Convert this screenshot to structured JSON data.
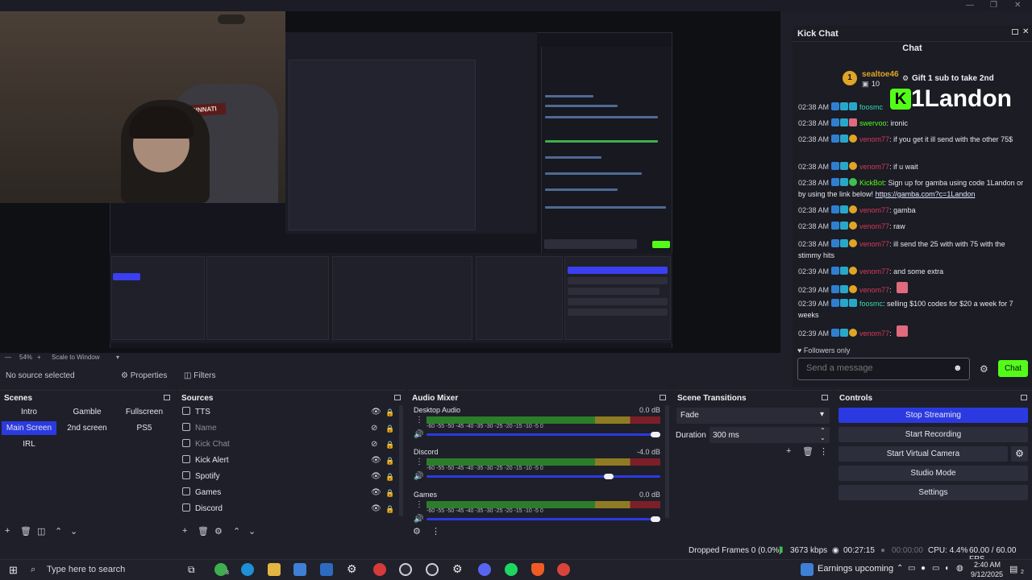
{
  "preview": {
    "cam_banner": "CINCINNATI",
    "zoom": "54%",
    "scale_mode": "Scale to Window"
  },
  "chat": {
    "dock_title": "Kick Chat",
    "title": "Chat",
    "pinned_user": "sealtoe46",
    "pinned_count": "10",
    "pinned_text": "Gift 1 sub to take 2nd",
    "overlay_name": "1Landon",
    "followers_only": "Followers only",
    "input_placeholder": "Send a message",
    "send_label": "Chat",
    "messages": [
      {
        "ts": "02:38 AM",
        "user": "foosmc",
        "text": "",
        "color": "teal"
      },
      {
        "ts": "02:38 AM",
        "user": "swervoo",
        "text": ": ironic",
        "color": "green"
      },
      {
        "ts": "02:38 AM",
        "user": "venom77",
        "text": ": if you get it ill send with the other 75$",
        "color": "red"
      },
      {
        "ts": "02:38 AM",
        "user": "venom77",
        "text": ": if u wait",
        "color": "red"
      },
      {
        "ts": "02:38 AM",
        "user": "KickBot",
        "text": ": Sign up for gamba using code 1Landon or by using the link below! ",
        "link": "https://gamba.com?c=1Landon",
        "color": "green"
      },
      {
        "ts": "02:38 AM",
        "user": "venom77",
        "text": ": gamba",
        "color": "red"
      },
      {
        "ts": "02:38 AM",
        "user": "venom77",
        "text": ": raw",
        "color": "red"
      },
      {
        "ts": "02:38 AM",
        "user": "venom77",
        "text": ": ill send the 25 with with 75 with the stimmy hits",
        "color": "red"
      },
      {
        "ts": "02:39 AM",
        "user": "venom77",
        "text": ": and some extra",
        "color": "red"
      },
      {
        "ts": "02:39 AM",
        "user": "venom77",
        "text": ":",
        "color": "red"
      },
      {
        "ts": "02:39 AM",
        "user": "foosmc",
        "text": ": selling $100 codes for $20 a week for 7 weeks",
        "color": "teal"
      },
      {
        "ts": "02:39 AM",
        "user": "venom77",
        "text": ":",
        "color": "red"
      }
    ]
  },
  "source_toolbar": {
    "no_source": "No source selected",
    "properties": "Properties",
    "filters": "Filters"
  },
  "scenes": {
    "title": "Scenes",
    "items": [
      "Intro",
      "Gamble",
      "Fullscreen",
      "Main Screen",
      "2nd screen",
      "PS5",
      "IRL"
    ],
    "selected": "Main Screen"
  },
  "sources": {
    "title": "Sources",
    "items": [
      "TTS",
      "Name",
      "Kick Chat",
      "Kick Alert",
      "Spotify",
      "Games",
      "Discord"
    ]
  },
  "mixer": {
    "title": "Audio Mixer",
    "scale": "-60  -55  -50  -45  -40  -35  -30  -25  -20  -15  -10   -5    0",
    "tracks": [
      {
        "name": "Desktop Audio",
        "db": "0.0 dB",
        "level": 1.0
      },
      {
        "name": "Discord",
        "db": "-4.0 dB",
        "level": 0.8
      },
      {
        "name": "Games",
        "db": "0.0 dB",
        "level": 1.0
      }
    ]
  },
  "transitions": {
    "title": "Scene Transitions",
    "type": "Fade",
    "duration_label": "Duration",
    "duration": "300 ms"
  },
  "controls": {
    "title": "Controls",
    "stop_streaming": "Stop Streaming",
    "start_recording": "Start Recording",
    "start_virtual_camera": "Start Virtual Camera",
    "studio_mode": "Studio Mode",
    "settings": "Settings"
  },
  "status": {
    "dropped": "Dropped Frames 0 (0.0%)",
    "bitrate": "3673 kbps",
    "stream_time": "00:27:15",
    "record_time": "00:00:00",
    "cpu": "CPU: 4.4%",
    "fps": "60.00 / 60.00 FPS"
  },
  "taskbar": {
    "search_placeholder": "Type here to search",
    "news": "Earnings upcoming",
    "time": "2:40 AM",
    "date": "9/12/2025",
    "xbox_badge": "3",
    "notif_count": "2"
  },
  "colors": {
    "accent": "#2b3ae0",
    "kick_green": "#53fc18",
    "user_red": "#d63a5b"
  }
}
